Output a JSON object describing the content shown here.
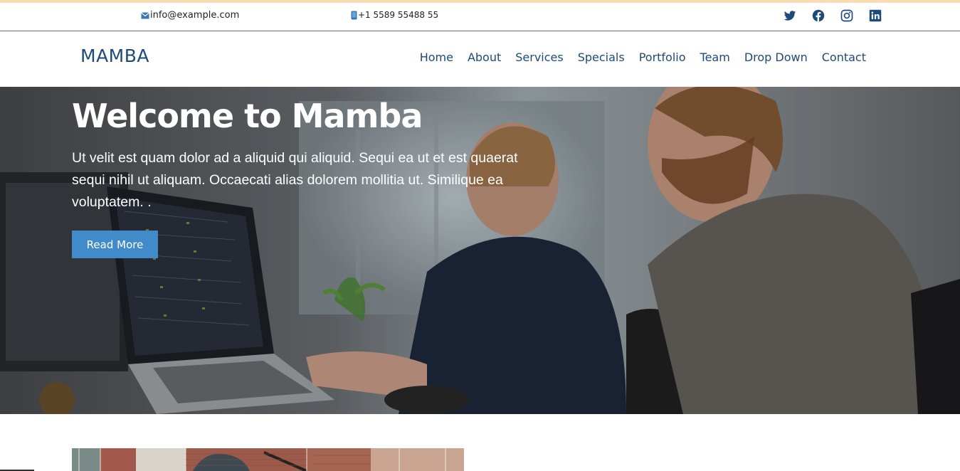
{
  "topbar": {
    "email": "info@example.com",
    "phone": "+1 5589 55488 55",
    "social": [
      {
        "icon": "twitter-icon"
      },
      {
        "icon": "facebook-icon"
      },
      {
        "icon": "instagram-icon"
      },
      {
        "icon": "linkedin-icon"
      }
    ]
  },
  "navbar": {
    "logo": "MAMBA",
    "menu": [
      "Home",
      "About",
      "Services",
      "Specials",
      "Portfolio",
      "Team",
      "Drop Down",
      "Contact"
    ]
  },
  "hero": {
    "title": "Welcome to Mamba",
    "text": "Ut velit est quam dolor ad a aliquid qui aliquid. Sequi ea ut et est quaerat sequi nihil ut aliquam. Occaecati alias dolorem mollitia ut. Similique ea voluptatem. .",
    "button": "Read More"
  },
  "colors": {
    "brand": "#1e4a7a",
    "button": "#428bca",
    "social": "#1e4a7a"
  }
}
